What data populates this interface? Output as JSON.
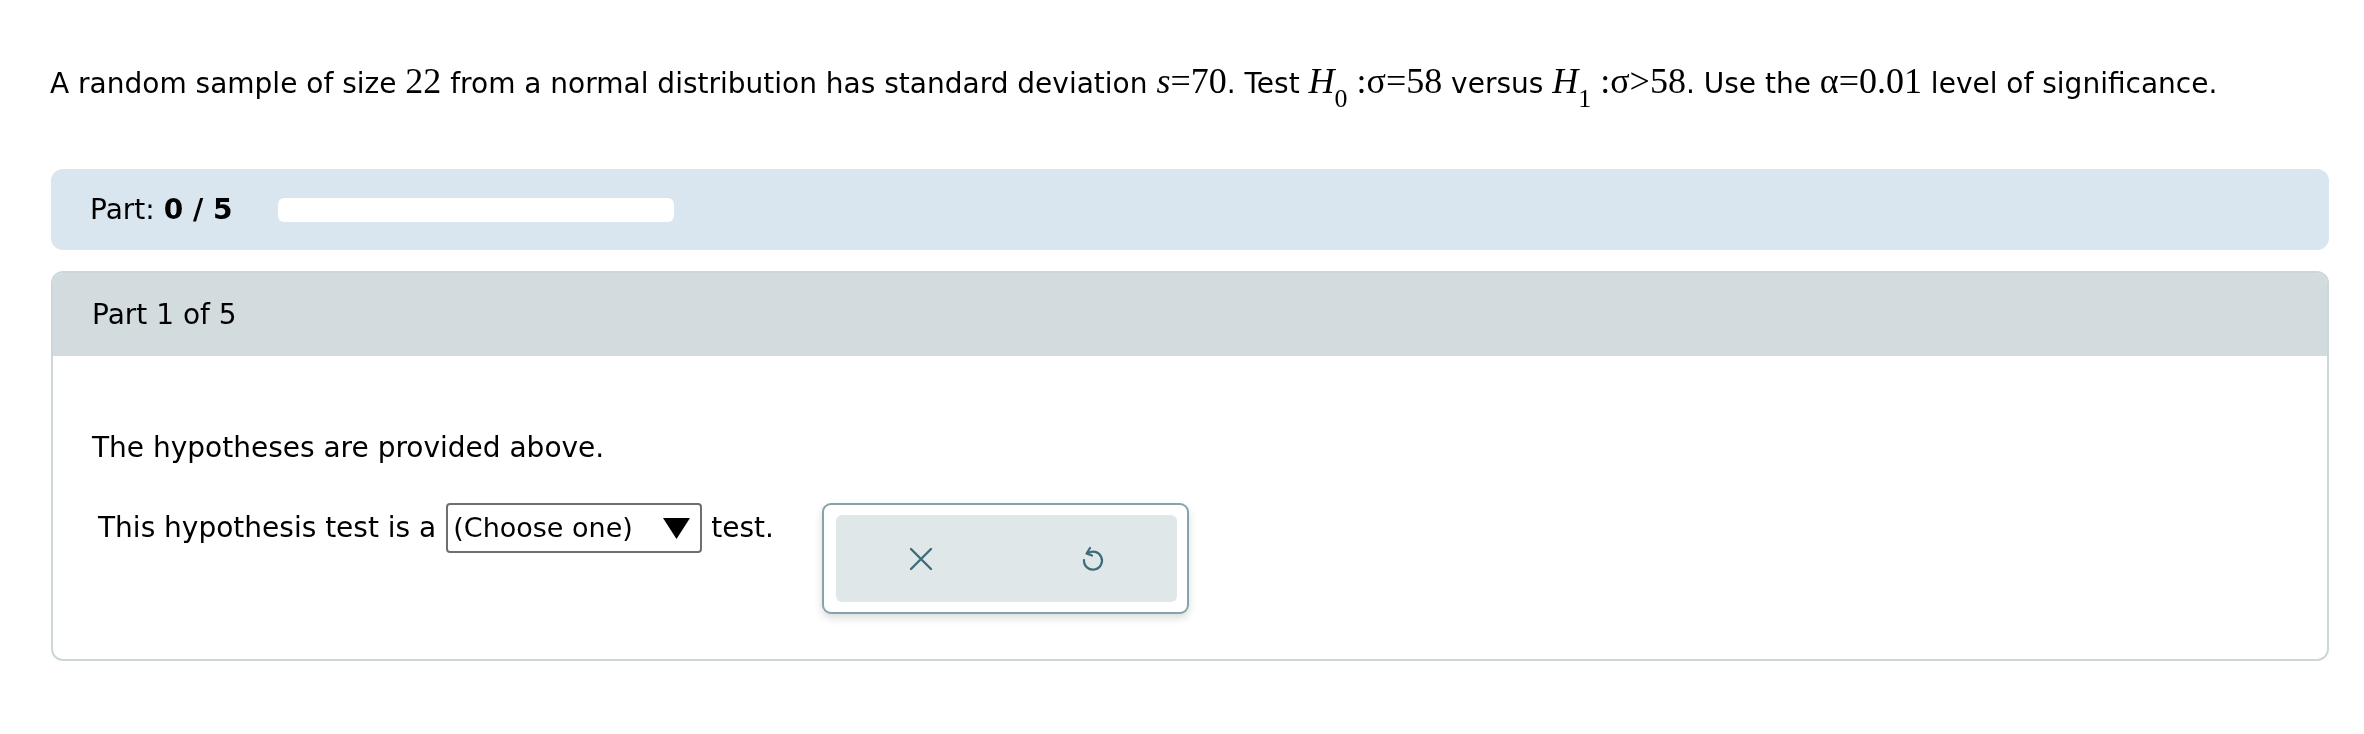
{
  "question": [
    {
      "kind": "text",
      "text": "A random sample of size "
    },
    {
      "kind": "math",
      "text": "22"
    },
    {
      "kind": "text",
      "text": " from a normal distribution has standard deviation "
    },
    {
      "kind": "math",
      "text": "*s*=70"
    },
    {
      "kind": "text",
      "text": ". Test "
    },
    {
      "kind": "math",
      "text": "*H*$_{0}$ :σ=58"
    },
    {
      "kind": "text",
      "text": " versus "
    },
    {
      "kind": "math",
      "text": "*H*$_{1}$ :σ>58"
    },
    {
      "kind": "text",
      "text": ". Use the "
    },
    {
      "kind": "math",
      "text": "α=0.01"
    },
    {
      "kind": "text",
      "text": " level of significance."
    }
  ],
  "progress": {
    "label": "Part:",
    "count": "0 / 5",
    "level": 0
  },
  "part": {
    "title": "Part 1 of 5",
    "instruction": "The hypotheses are provided above.",
    "prompt_before": "This hypothesis test is a",
    "select": {
      "value": "(Choose one)"
    },
    "prompt_after": "test."
  }
}
